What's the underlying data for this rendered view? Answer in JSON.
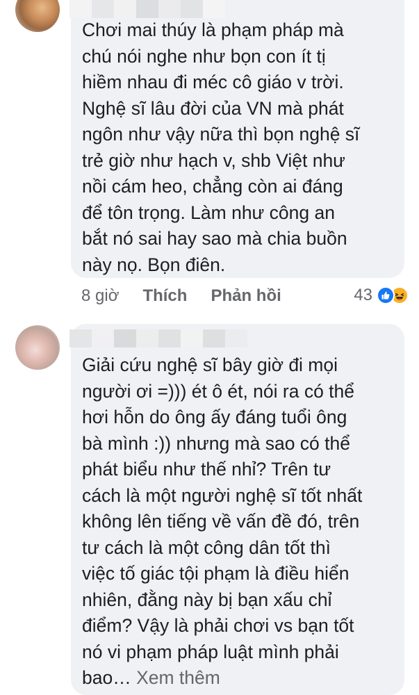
{
  "comments": [
    {
      "text_lines": [
        "Chơi mai thúy là phạm pháp mà",
        "chú nói nghe như bọn con ít tị",
        "hiềm nhau đi méc cô giáo v trời.",
        "Nghệ sĩ lâu đời của VN mà phát",
        "ngôn như vậy nữa thì bọn nghệ sĩ",
        "trẻ giờ như hạch v, shb Việt như",
        "nồi cám heo, chẳng còn ai đáng",
        "để tôn trọng. Làm như công an",
        "bắt nó sai hay sao mà chia buồn",
        "này nọ. Bọn điên."
      ],
      "time": "8 giờ",
      "like_label": "Thích",
      "reply_label": "Phản hồi",
      "reaction_count": "43",
      "reaction_icons": [
        "like-icon",
        "haha-icon"
      ]
    },
    {
      "text_lines": [
        "Giải cứu nghệ sĩ bây giờ đi mọi",
        "người ơi =))) ét ô ét, nói ra có thể",
        "hơi hỗn do ông ấy đáng tuổi ông",
        "bà mình :)) nhưng mà sao có thể",
        "phát biểu như thế nhỉ? Trên tư",
        "cách là một người nghệ sĩ tốt nhất",
        "không lên tiếng về vấn đề đó, trên",
        "tư cách là một công dân tốt thì",
        "việc tố giác tội phạm là điều hiển",
        "nhiên, đằng này bị bạn xấu chỉ",
        "điểm? Vậy là phải chơi vs bạn tốt",
        "nó vi phạm pháp luật mình phải"
      ],
      "last_line": "bao…",
      "see_more_label": " Xem thêm"
    }
  ],
  "colors": {
    "bubble": "#eff1f4",
    "text": "#1c1e21",
    "secondary": "#65676b",
    "like": "#1877f2",
    "haha": "#f7b125"
  }
}
